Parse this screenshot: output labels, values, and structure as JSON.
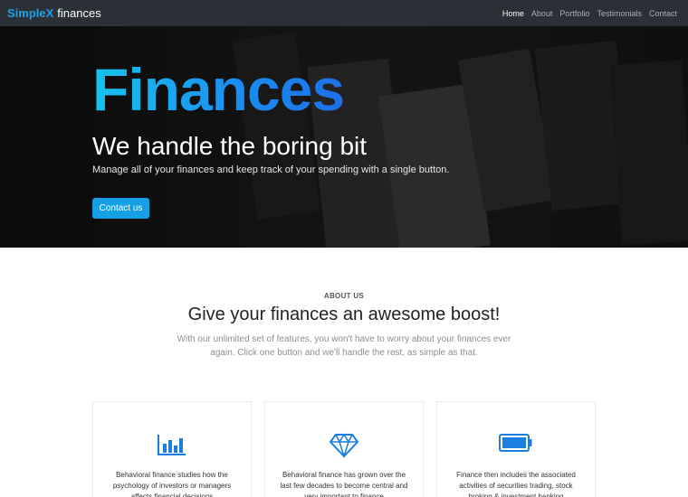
{
  "navbar": {
    "brand_primary": "SimpleX",
    "brand_secondary": "finances",
    "links": [
      "Home",
      "About",
      "Portfolio",
      "Testimonials",
      "Contact"
    ],
    "active_link": "Home"
  },
  "hero": {
    "title": "Finances",
    "subtitle": "We handle the boring bit",
    "description": "Manage all of your finances and keep track of your spending with a single button.",
    "button_label": "Contact us"
  },
  "about": {
    "label": "ABOUT US",
    "heading": "Give your finances an awesome boost!",
    "text": "With our unlimited set of features, you won't have to worry about your finances ever again. Click one button and we'll handle the rest, as simple as that."
  },
  "features": [
    {
      "icon": "bar-chart-icon",
      "text": "Behavioral finance studies how the psychology of investors or managers affects financial decisions"
    },
    {
      "icon": "diamond-icon",
      "text": "Behavioral finance has grown over the last few decades to become central and very important to finance"
    },
    {
      "icon": "battery-icon",
      "text": "Finance then includes the associated activities of securities trading, stock broking & investment banking"
    }
  ],
  "colors": {
    "accent": "#16a0e4",
    "navbar": "#2b2f36",
    "icon_blue": "#1a7fe0"
  }
}
